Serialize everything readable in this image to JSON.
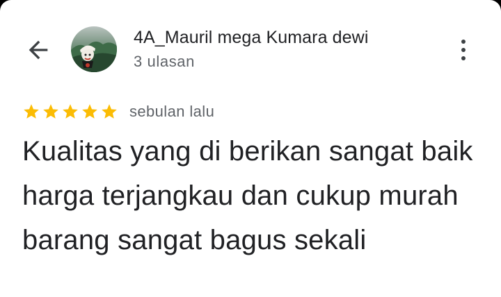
{
  "header": {
    "back_icon": "arrow-left-icon",
    "avatar_icon": "user-avatar-photo",
    "reviewer_name": "4A_Mauril mega Kumara dewi",
    "review_count": "3 ulasan",
    "menu_icon": "more-vertical-icon"
  },
  "review": {
    "rating": 5,
    "rating_max": 5,
    "time": "sebulan lalu",
    "text": "Kualitas yang di berikan sangat baik harga terjangkau dan cukup murah barang sangat bagus sekali"
  },
  "colors": {
    "star": "#fbbc04",
    "text_primary": "#202124",
    "text_secondary": "#5f6368"
  }
}
